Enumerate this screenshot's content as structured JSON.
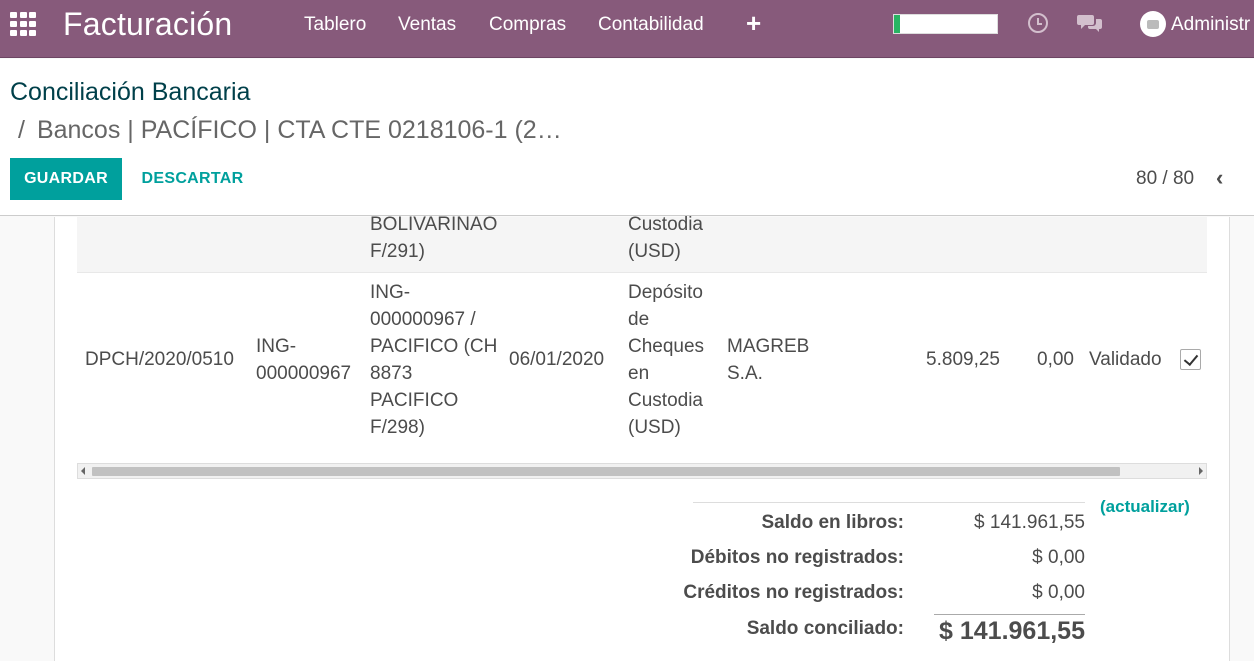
{
  "navbar": {
    "app_title": "Facturación",
    "menu": [
      "Tablero",
      "Ventas",
      "Compras",
      "Contabilidad"
    ],
    "plus_symbol": "+",
    "progress_fraction": 0.06,
    "progress_color": "#28b463",
    "user_name": "Administr",
    "icons": [
      "apps-grid-icon",
      "clock-icon",
      "chat-icon",
      "camera-icon"
    ]
  },
  "breadcrumb": {
    "first": "Conciliación Bancaria",
    "separator": "/",
    "current": "Bancos | PACÍFICO | CTA CTE 0218106-1 (2…"
  },
  "actions": {
    "save": "GUARDAR",
    "discard": "DESCARTAR"
  },
  "pager": {
    "value": "80 / 80",
    "prev_symbol": "‹"
  },
  "rows": [
    {
      "reference_lines": [
        "BOLIVARINAO",
        "F/291)"
      ],
      "description_lines": [
        "Custodia",
        "(USD)"
      ]
    },
    {
      "move": "DPCH/2020/0510",
      "number_lines": [
        "ING-",
        "000000967"
      ],
      "reference_lines": [
        "ING-",
        "000000967 /",
        "PACIFICO (CH",
        "8873",
        "PACIFICO",
        "F/298)"
      ],
      "date": "06/01/2020",
      "description_lines": [
        "Depósito",
        "de",
        "Cheques",
        "en",
        "Custodia",
        "(USD)"
      ],
      "partner_lines": [
        "MAGREB",
        "S.A."
      ],
      "debit": "5.809,25",
      "credit": "0,00",
      "status": "Validado",
      "checked": true
    }
  ],
  "totals": {
    "book_balance_label": "Saldo en libros:",
    "book_balance": "$ 141.961,55",
    "refresh_link": "(actualizar)",
    "unregistered_debits_label": "Débitos no registrados:",
    "unregistered_debits": "$ 0,00",
    "unregistered_credits_label": "Créditos no registrados:",
    "unregistered_credits": "$ 0,00",
    "reconciled_balance_label": "Saldo conciliado:",
    "reconciled_balance": "$ 141.961,55"
  },
  "colors": {
    "navbar": "#875a7b",
    "primary": "#00a09d"
  }
}
